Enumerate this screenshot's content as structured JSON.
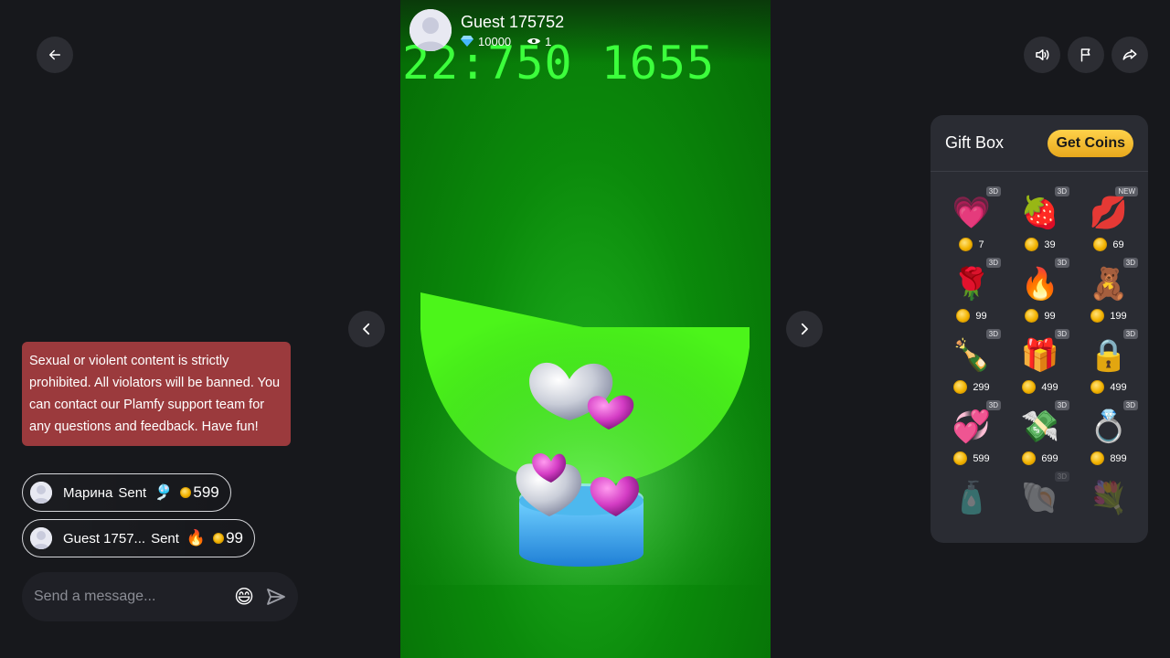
{
  "host": {
    "name": "Guest 175752",
    "diamonds": "10000",
    "viewers": "1"
  },
  "stage": {
    "counter_text": "22:750 1655"
  },
  "chat": {
    "notice": "Sexual or violent content is strictly prohibited. All violators will be banned. You can contact our Plamfy support team for any questions and feedback. Have fun!",
    "gifts": [
      {
        "name": "Марина",
        "sent": "Sent",
        "gift_icon": "🎐",
        "amount": "599"
      },
      {
        "name": "Guest 1757...",
        "sent": "Sent",
        "gift_icon": "🔥",
        "amount": "99"
      }
    ],
    "input_placeholder": "Send a message...",
    "emoji_icon": "😄"
  },
  "giftbox": {
    "title": "Gift Box",
    "get_coins_label": "Get Coins",
    "items": [
      {
        "icon": "💗",
        "tag": "3D",
        "price": "7"
      },
      {
        "icon": "🍓",
        "tag": "3D",
        "price": "39"
      },
      {
        "icon": "💋",
        "tag": "NEW",
        "price": "69"
      },
      {
        "icon": "🌹",
        "tag": "3D",
        "price": "99"
      },
      {
        "icon": "🔥",
        "tag": "3D",
        "price": "99"
      },
      {
        "icon": "🧸",
        "tag": "3D",
        "price": "199"
      },
      {
        "icon": "🍾",
        "tag": "3D",
        "price": "299"
      },
      {
        "icon": "🎁",
        "tag": "3D",
        "price": "499"
      },
      {
        "icon": "🔒",
        "tag": "3D",
        "price": "499"
      },
      {
        "icon": "💞",
        "tag": "3D",
        "price": "599"
      },
      {
        "icon": "💸",
        "tag": "3D",
        "price": "699"
      },
      {
        "icon": "💍",
        "tag": "3D",
        "price": "899"
      },
      {
        "icon": "🧴",
        "tag": "",
        "price": ""
      },
      {
        "icon": "🐚",
        "tag": "3D",
        "price": ""
      },
      {
        "icon": "💐",
        "tag": "",
        "price": ""
      }
    ]
  },
  "colors": {
    "background": "#17181c",
    "notice": "#9b3a3d",
    "accent_coin": "#f2b300",
    "stage_green": "#0b8a0b"
  }
}
